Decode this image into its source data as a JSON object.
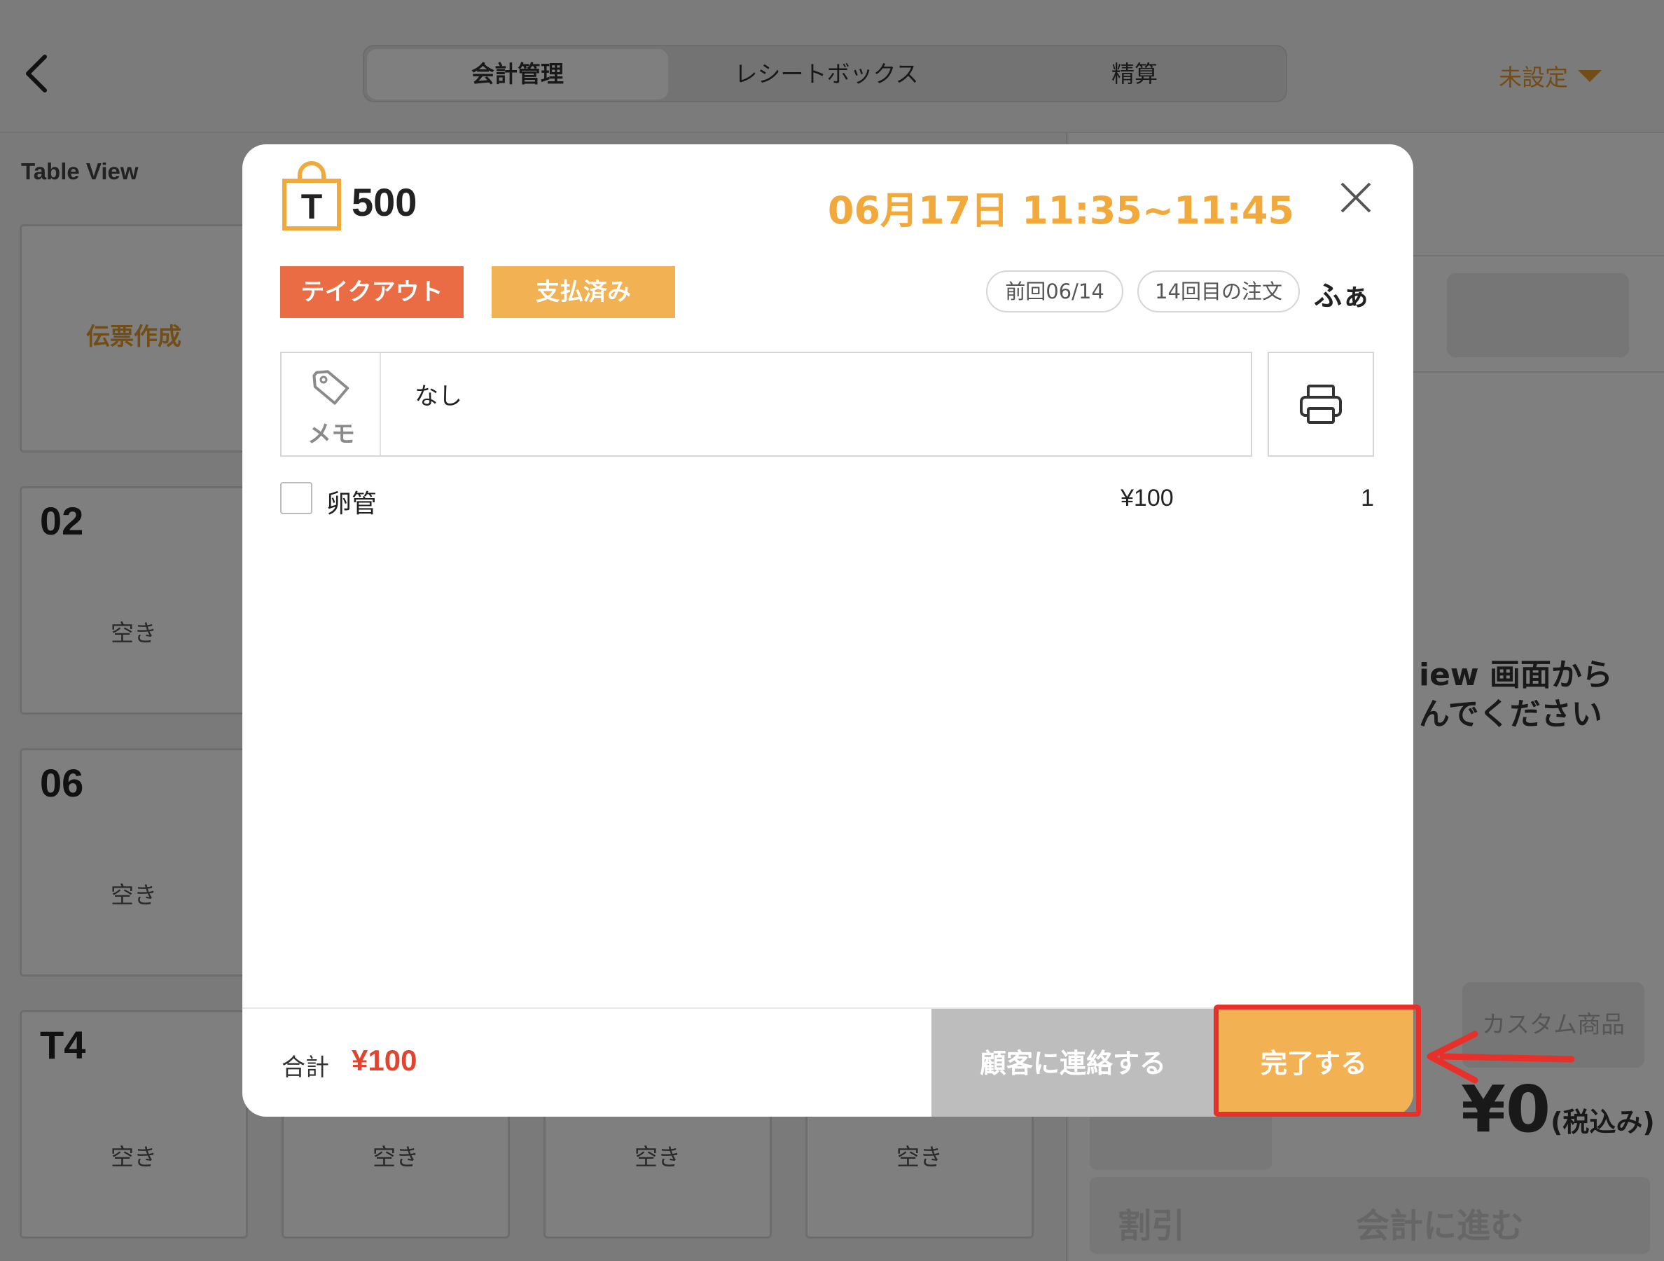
{
  "header": {
    "tabs": [
      {
        "label": "会計管理",
        "active": true
      },
      {
        "label": "レシートボックス",
        "active": false
      },
      {
        "label": "精算",
        "active": false
      }
    ],
    "store_label": "未設定"
  },
  "left_panel": {
    "title": "Table View",
    "create_label": "伝票作成",
    "tables": [
      {
        "num": "02",
        "status": "空き"
      },
      {
        "num": "06",
        "status": "空き"
      },
      {
        "num": "T4",
        "status": "空き"
      }
    ],
    "bottom_row_status": [
      "空き",
      "空き",
      "空き"
    ]
  },
  "right_panel": {
    "message_line1": "iew 画面から",
    "message_line2": "んでください",
    "custom_item_label": "カスタム商品",
    "total": "¥0",
    "tax_note": "(税込み)",
    "discount_label": "割引",
    "checkout_label": "会計に進む"
  },
  "modal": {
    "order_number": "500",
    "time": "06月17日 11:35~11:45",
    "tags": {
      "takeout": "テイクアウト",
      "paid": "支払済み"
    },
    "last_visit": "前回06/14",
    "order_count": "14回目の注文",
    "customer": "ふぁ",
    "memo_label": "メモ",
    "memo_text": "なし",
    "items": [
      {
        "name": "卵管",
        "price": "¥100",
        "qty": "1"
      }
    ],
    "total_label": "合計",
    "total_value": "¥100",
    "contact_label": "顧客に連絡する",
    "done_label": "完了する"
  },
  "colors": {
    "accent_orange": "#f2b152",
    "takeout_red": "#e96c44",
    "total_red": "#e2452f",
    "highlight_red": "#e8302a"
  }
}
